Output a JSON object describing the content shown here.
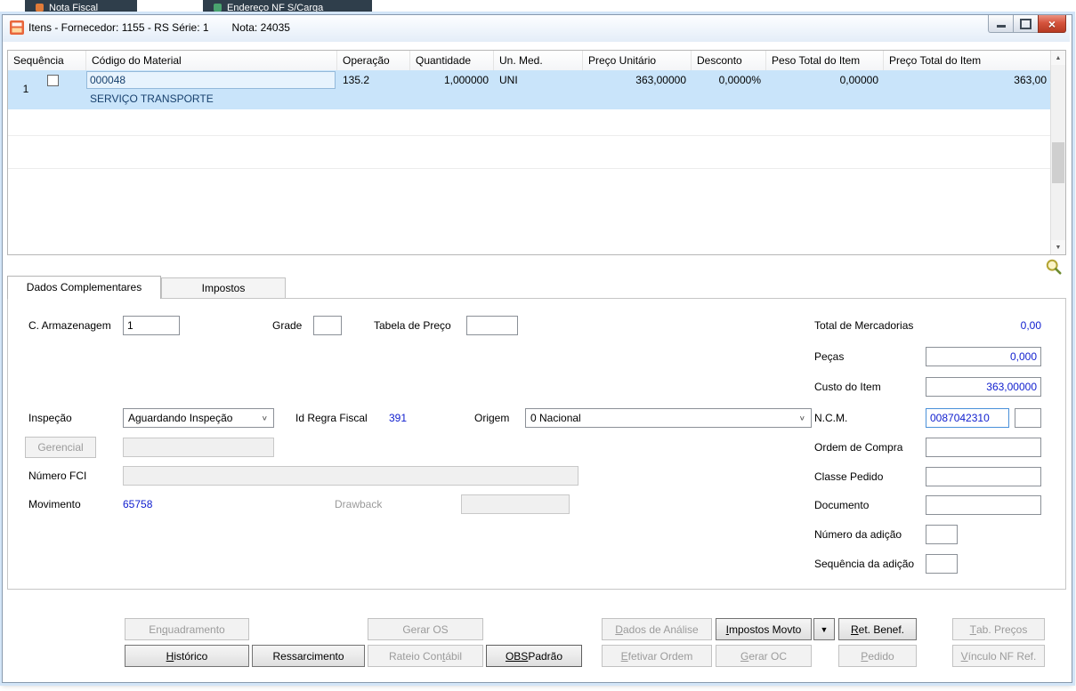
{
  "background_tabs": {
    "tab1": "Nota Fiscal",
    "tab2": "Endereço NF S/Carga"
  },
  "window": {
    "title_left": "Itens - Fornecedor: 1155 - RS Série: 1",
    "title_right": "Nota: 24035"
  },
  "icons": {
    "chevron_down": "∨",
    "dropdown_arrow": "▼",
    "scroll_up": "▲",
    "scroll_down": "▼",
    "close": "×"
  },
  "grid": {
    "columns": [
      "Sequência",
      "Código do Material",
      "Operação",
      "Quantidade",
      "Un. Med.",
      "Preço Unitário",
      "Desconto",
      "Peso Total do Item",
      "Preço Total do Item"
    ],
    "row": {
      "sequencia": "1",
      "codigo": "000048",
      "descricao": "SERVIÇO TRANSPORTE",
      "operacao": "135.2",
      "quantidade": "1,000000",
      "un_med": "UNI",
      "preco_unitario": "363,00000",
      "desconto": "0,0000%",
      "peso_total": "0,00000",
      "preco_total": "363,00"
    }
  },
  "tabs": {
    "dados_complementares": "Dados Complementares",
    "impostos": "Impostos"
  },
  "fields": {
    "c_armazenagem": {
      "label": "C. Armazenagem",
      "value": "1"
    },
    "grade": {
      "label": "Grade",
      "value": ""
    },
    "tabela_de_preco": {
      "label": "Tabela de Preço",
      "value": ""
    },
    "total_de_mercadorias": {
      "label": "Total de Mercadorias",
      "value": "0,00"
    },
    "pecas": {
      "label": "Peças",
      "value": "0,000"
    },
    "custo_do_item": {
      "label": "Custo do Item",
      "value": "363,00000"
    },
    "inspecao": {
      "label": "Inspeção",
      "value": "Aguardando Inspeção"
    },
    "id_regra_fiscal": {
      "label": "Id Regra Fiscal",
      "value": "391"
    },
    "origem": {
      "label": "Origem",
      "value": "0 Nacional"
    },
    "ncm": {
      "label": "N.C.M.",
      "value": "0087042310",
      "value2": ""
    },
    "gerencial": {
      "label": "Gerencial",
      "value": ""
    },
    "ordem_de_compra": {
      "label": "Ordem de Compra",
      "value": ""
    },
    "numero_fci": {
      "label": "Número FCI",
      "value": ""
    },
    "classe_pedido": {
      "label": "Classe Pedido",
      "value": ""
    },
    "movimento": {
      "label": "Movimento",
      "value": "65758"
    },
    "drawback": {
      "label": "Drawback",
      "value": ""
    },
    "documento": {
      "label": "Documento",
      "value": ""
    },
    "numero_da_adicao": {
      "label": "Número da adição",
      "value": ""
    },
    "sequencia_da_adicao": {
      "label": "Sequência da adição",
      "value": ""
    }
  },
  "buttons": {
    "enquadramento": {
      "pre": "En",
      "ul": "q",
      "post": "uadramento",
      "enabled": false
    },
    "gerar_os": {
      "pre": "Gerar OS",
      "ul": "",
      "post": "",
      "enabled": false
    },
    "dados_de_analise": {
      "pre": "",
      "ul": "D",
      "post": "ados de Análise",
      "enabled": false
    },
    "impostos_movto": {
      "pre": "",
      "ul": "I",
      "post": "mpostos Movto",
      "enabled": true
    },
    "ret_benef": {
      "pre": "",
      "ul": "R",
      "post": "et. Benef.",
      "enabled": true
    },
    "tab_precos": {
      "pre": "",
      "ul": "T",
      "post": "ab. Preços",
      "enabled": false
    },
    "historico": {
      "pre": "",
      "ul": "H",
      "post": "istórico",
      "enabled": true
    },
    "ressarcimento": {
      "pre": "Ressarcimento",
      "ul": "",
      "post": "",
      "enabled": true
    },
    "rateio_contabil": {
      "pre": "Rateio Con",
      "ul": "t",
      "post": "ábil",
      "enabled": false
    },
    "obs_padrao": {
      "pre": "",
      "ul": "OBS",
      "post": " Padrão",
      "enabled": true
    },
    "efetivar_ordem": {
      "pre": "",
      "ul": "E",
      "post": "fetivar Ordem",
      "enabled": false
    },
    "gerar_oc": {
      "pre": "",
      "ul": "G",
      "post": "erar OC",
      "enabled": false
    },
    "pedido": {
      "pre": "",
      "ul": "P",
      "post": "edido",
      "enabled": false
    },
    "vinculo_nf_ref": {
      "pre": "",
      "ul": "V",
      "post": "ínculo NF Ref.",
      "enabled": false
    }
  }
}
